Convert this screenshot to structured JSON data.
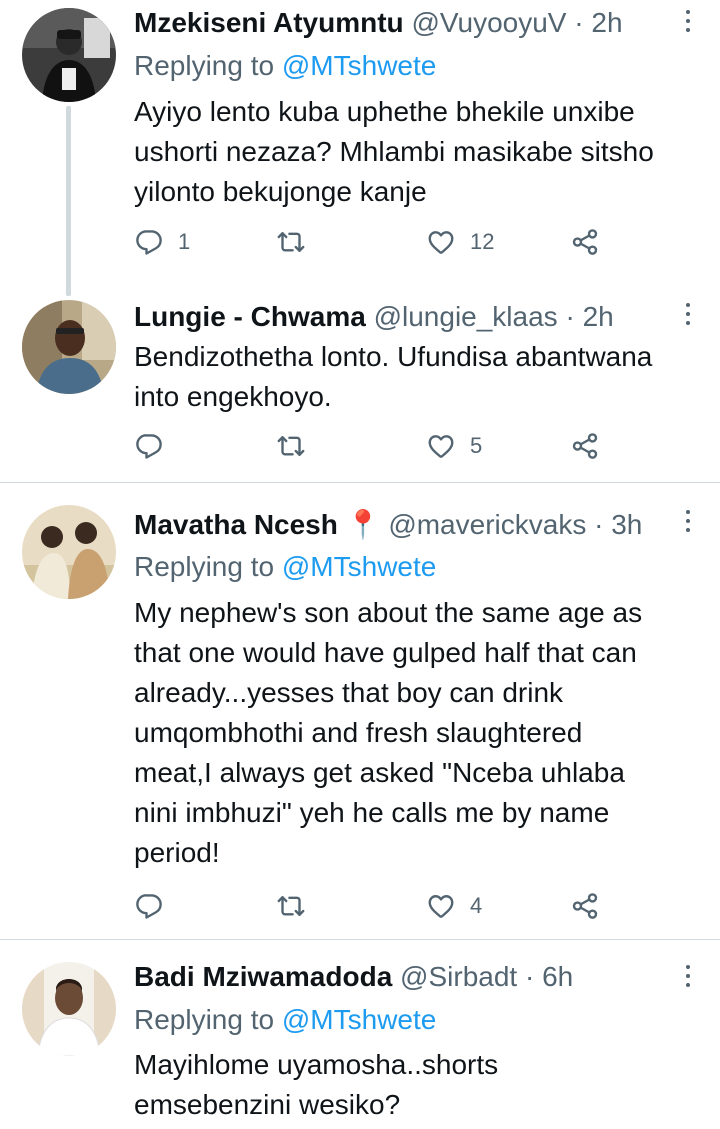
{
  "tweets": [
    {
      "name": "Mzekiseni Atyumntu",
      "handle": "@VuyooyuV",
      "separator": "·",
      "time": "2h",
      "replying_prefix": "Replying to ",
      "replying_to": "@MTshwete",
      "text_lines": [
        "Ayiyo lento kuba uphethe bhekile unxibe",
        "ushorti nezaza? Mhlambi masikabe sitsho",
        "yilonto bekujonge kanje"
      ],
      "replies": "1",
      "retweets": "",
      "likes": "12"
    },
    {
      "name": "Lungie - Chwama",
      "handle": "@lungie_klaas",
      "separator": "·",
      "time": "2h",
      "text_lines": [
        "Bendizothetha lonto. Ufundisa abantwana",
        "into engekhoyo."
      ],
      "replies": "",
      "retweets": "",
      "likes": "5"
    },
    {
      "name": "Mavatha Ncesh",
      "name_emoji": "📍",
      "handle": "@maverickvaks",
      "separator": "·",
      "time": "3h",
      "replying_prefix": "Replying to ",
      "replying_to": "@MTshwete",
      "text_lines": [
        "My nephew's son about the same age as",
        "that one would have gulped half that can",
        "already...yesses that boy can drink",
        "umqombhothi and fresh slaughtered",
        "meat,I always get asked \"Nceba uhlaba",
        "nini imbhuzi\" yeh he calls me by name",
        "period!"
      ],
      "replies": "",
      "retweets": "",
      "likes": "4"
    },
    {
      "name": "Badi Mziwamadoda",
      "handle": "@Sirbadt",
      "separator": "·",
      "time": "6h",
      "replying_prefix": "Replying to ",
      "replying_to": "@MTshwete",
      "text_lines": [
        "Mayihlome uyamosha..shorts",
        "emsebenzini wesiko?"
      ]
    }
  ],
  "colors": {
    "text": "#0f1419",
    "secondary": "#536471",
    "mention": "#1d9bf0",
    "divider": "#cfd9de"
  },
  "icons": [
    "reply-icon",
    "retweet-icon",
    "like-icon",
    "share-icon",
    "more-options-icon"
  ]
}
